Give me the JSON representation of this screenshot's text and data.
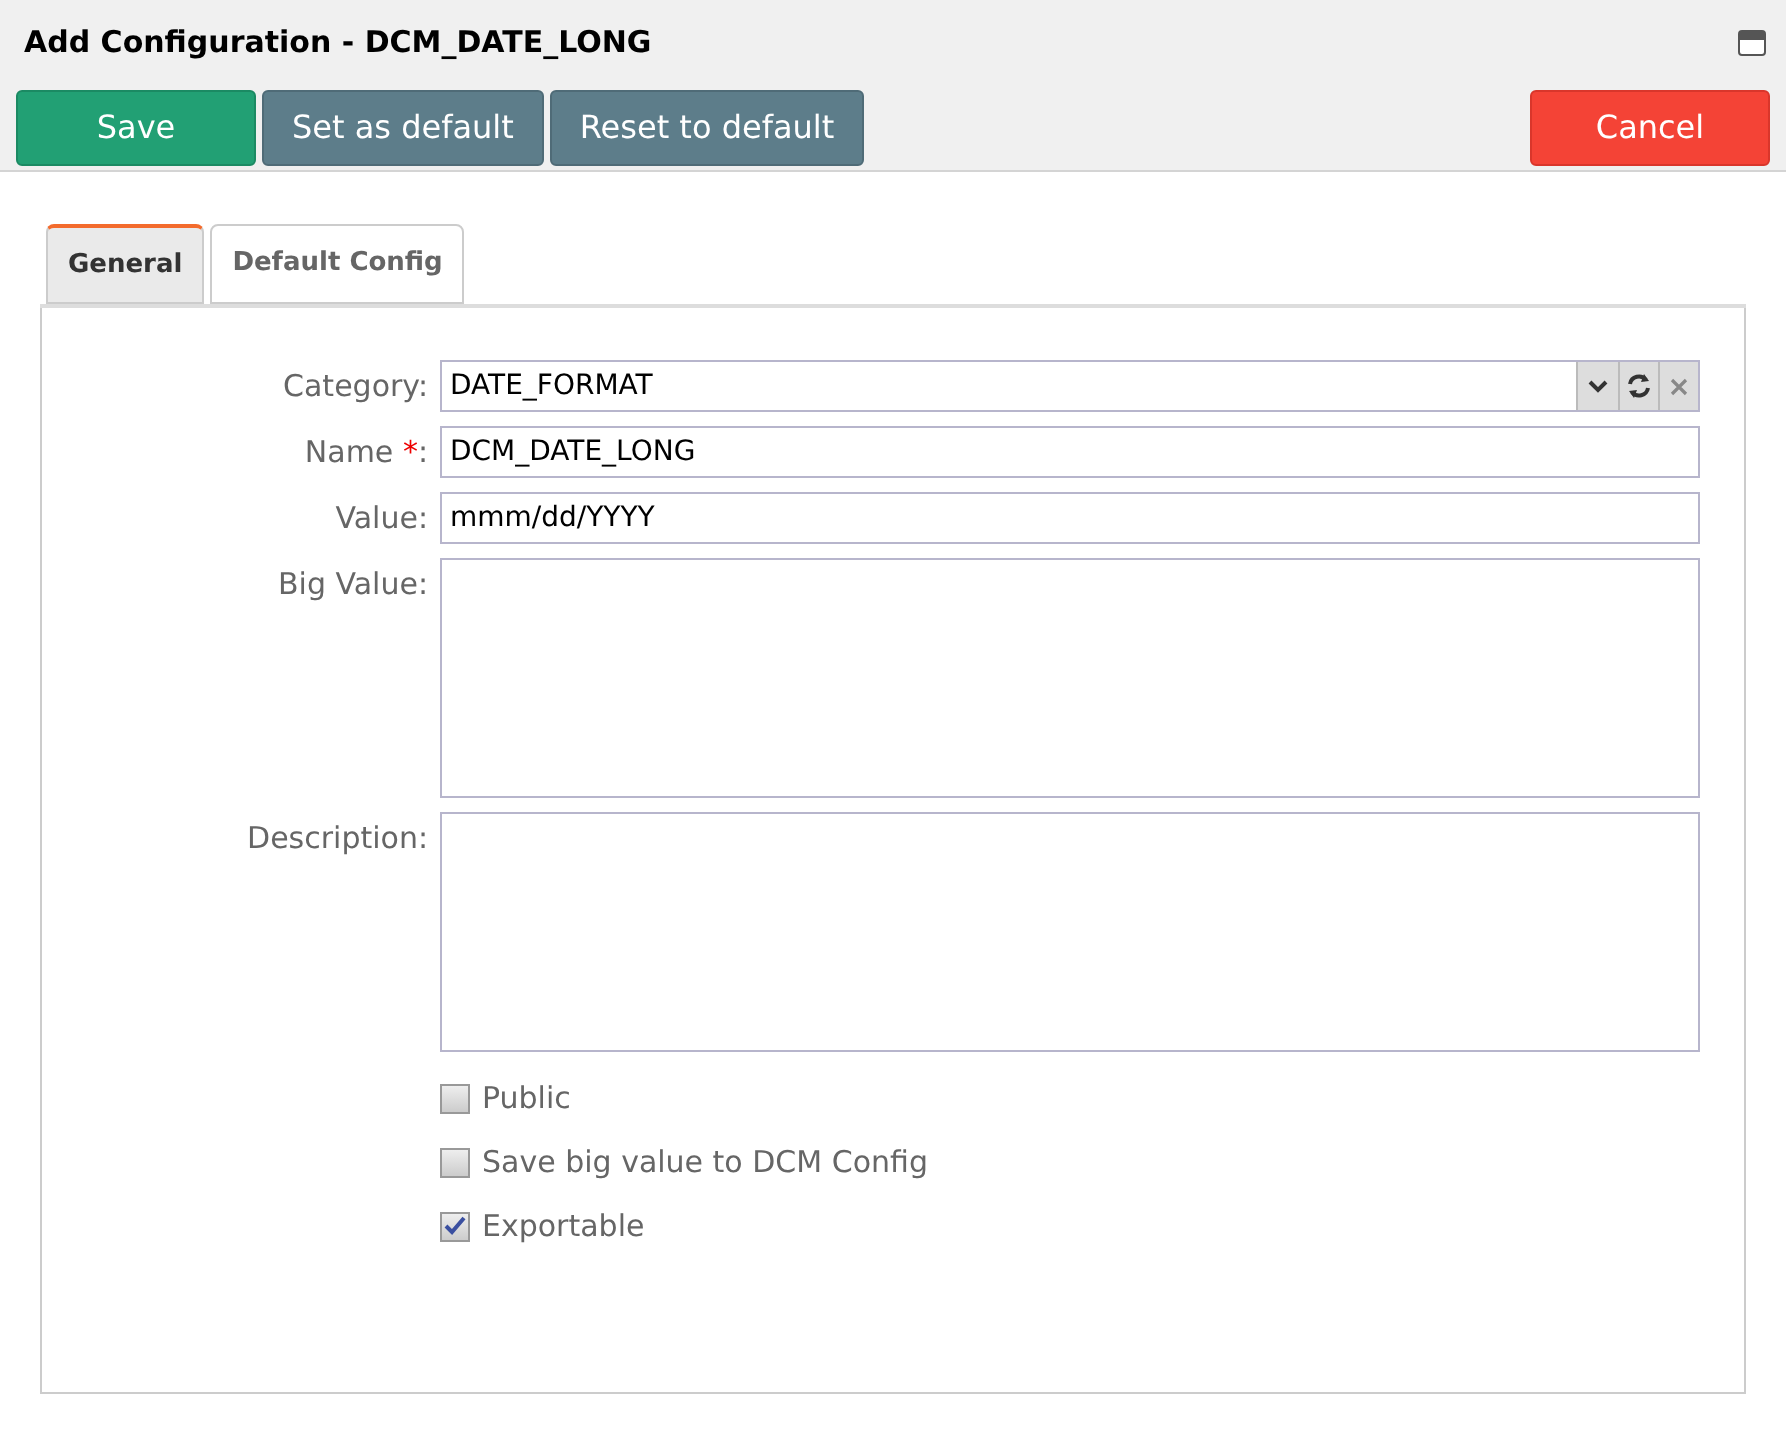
{
  "window": {
    "title": "Add Configuration - DCM_DATE_LONG"
  },
  "toolbar": [
    {
      "label": "Save",
      "kind": "primary"
    },
    {
      "label": "Set as default",
      "kind": "secondary"
    },
    {
      "label": "Reset to default",
      "kind": "secondary"
    },
    {
      "label": "Cancel",
      "kind": "danger"
    }
  ],
  "tabs": [
    {
      "label": "General",
      "selected": true
    },
    {
      "label": "Default Config",
      "selected": false
    }
  ],
  "fields": [
    {
      "label": "Category:",
      "kind": "select",
      "value": "DATE_FORMAT"
    },
    {
      "label": "Name",
      "kind": "text",
      "value": "DCM_DATE_LONG",
      "required_mark": "*",
      "suffix": ":"
    },
    {
      "label": "Value:",
      "kind": "text",
      "value": "mmm/dd/YYYY"
    },
    {
      "label": "Big Value:",
      "kind": "textarea"
    },
    {
      "label": "Description:",
      "kind": "textarea"
    }
  ],
  "checkboxes": [
    {
      "label": "Public",
      "checked": false
    },
    {
      "label": "Save big value to DCM Config",
      "checked": false
    },
    {
      "label": "Exportable",
      "checked": true
    }
  ]
}
